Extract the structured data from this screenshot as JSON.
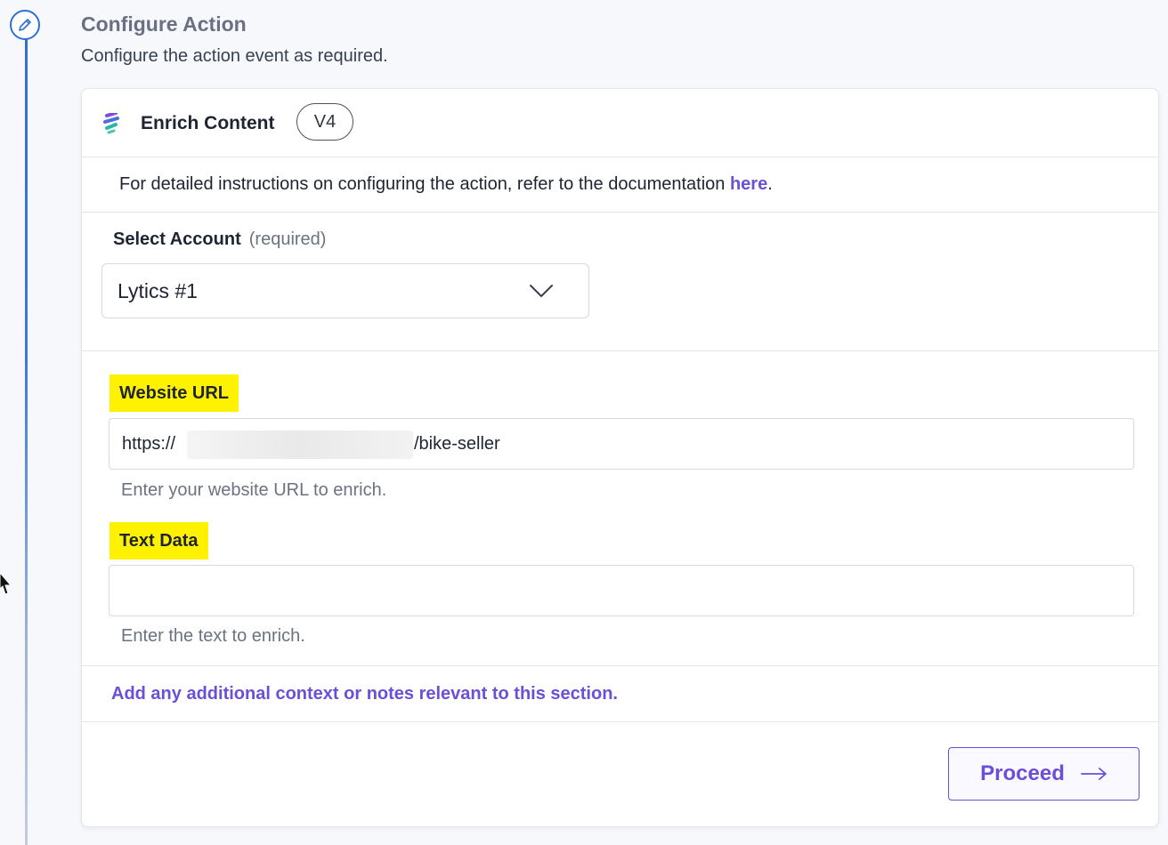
{
  "step": {
    "title": "Configure Action",
    "subtitle": "Configure the action event as required.",
    "icon": "pencil-icon"
  },
  "card": {
    "app_name": "Enrich Content",
    "app_logo": "stacked-layers-logo",
    "version": "V4",
    "doc_text": "For detailed instructions on configuring the action, refer to the documentation ",
    "doc_link": "here",
    "doc_period": "."
  },
  "account": {
    "label": "Select Account",
    "required": "(required)",
    "selected": "Lytics #1"
  },
  "website_url": {
    "label": "Website URL",
    "value_prefix": "https://",
    "value_suffix": "/bike-seller",
    "help": "Enter your website URL to enrich."
  },
  "text_data": {
    "label": "Text Data",
    "value": "",
    "help": "Enter the text to enrich."
  },
  "notes_link": "Add any additional context or notes relevant to this section.",
  "proceed_button": "Proceed",
  "colors": {
    "accent": "#6b4fd8",
    "timeline": "#2f6fd6",
    "highlight": "#fff200"
  }
}
